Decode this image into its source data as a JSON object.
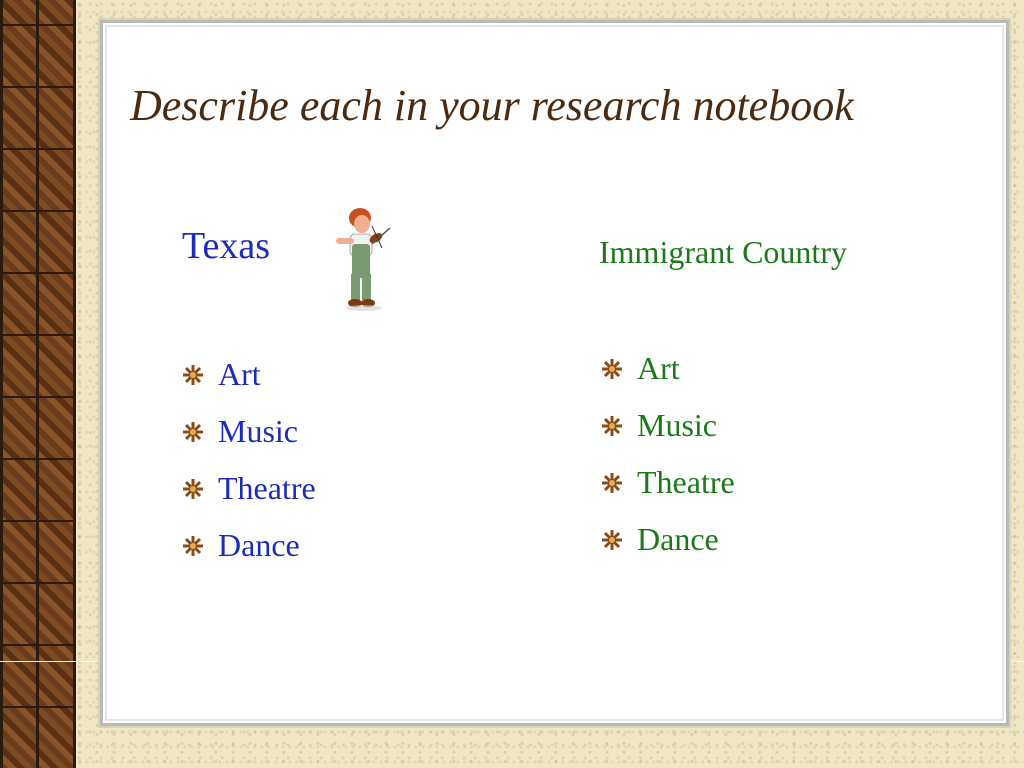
{
  "slide": {
    "title": "Describe each in your research notebook",
    "left_column": {
      "heading": "Texas",
      "items": [
        "Art",
        "Music",
        "Theatre",
        "Dance"
      ]
    },
    "right_column": {
      "heading": "Immigrant Country",
      "items": [
        "Art",
        "Music",
        "Theatre",
        "Dance"
      ]
    },
    "decoration": {
      "clipart": "fiddler-playing-violin",
      "bullet_icon": "sun-star-bullet-icon"
    },
    "colors": {
      "title": "#4a2a10",
      "left_text": "#1c2cb8",
      "right_text": "#1a7a1a",
      "background": "#efe6c3",
      "wood_border": "#6b3c1c"
    }
  }
}
